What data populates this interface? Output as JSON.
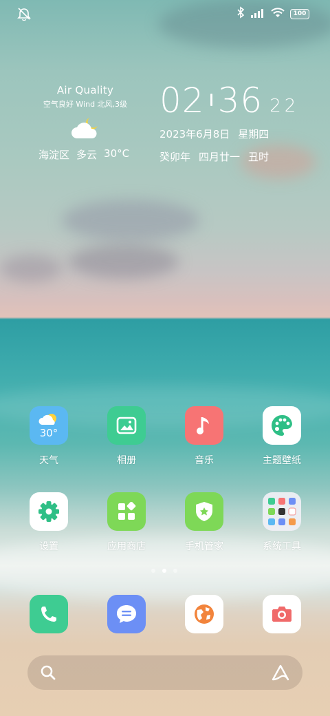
{
  "status_bar": {
    "left_icon": "mute-icon",
    "right_icons": [
      "bluetooth-icon",
      "signal-icon",
      "wifi-icon"
    ],
    "battery": "100"
  },
  "weather_widget": {
    "title": "Air Quality",
    "subtitle": "空气良好 Wind 北风,3级",
    "icon": "cloudy-night-icon",
    "district": "海淀区",
    "condition": "多云",
    "temperature": "30°C"
  },
  "clock_widget": {
    "hour": "02",
    "minute": "36",
    "second": "22",
    "date": "2023年6月8日",
    "weekday": "星期四",
    "lunar_year": "癸卯年",
    "lunar_date": "四月廿一",
    "lunar_hour": "丑时"
  },
  "apps_row1": [
    {
      "label": "天气",
      "icon": "weather-icon",
      "badge": "30°",
      "color": "#5bb8f2"
    },
    {
      "label": "相册",
      "icon": "gallery-icon",
      "color": "#3ecc92"
    },
    {
      "label": "音乐",
      "icon": "music-icon",
      "color": "#f77474"
    },
    {
      "label": "主题壁纸",
      "icon": "theme-palette-icon",
      "color": "#ffffff"
    }
  ],
  "apps_row2": [
    {
      "label": "设置",
      "icon": "settings-gear-icon",
      "color": "#ffffff"
    },
    {
      "label": "应用商店",
      "icon": "app-store-icon",
      "color": "#7ed857"
    },
    {
      "label": "手机管家",
      "icon": "security-shield-icon",
      "color": "#7ed857"
    },
    {
      "label": "系统工具",
      "icon": "folder-icon",
      "color": "#e8e8ee"
    }
  ],
  "pager": {
    "pages": 3,
    "active": 2
  },
  "dock": [
    {
      "name": "phone",
      "icon": "phone-icon",
      "color": "#3ecc92"
    },
    {
      "name": "messages",
      "icon": "message-icon",
      "color": "#6c8ff5"
    },
    {
      "name": "browser",
      "icon": "browser-globe-icon",
      "color": "#ffffff"
    },
    {
      "name": "camera",
      "icon": "camera-icon",
      "color": "#ffffff"
    }
  ],
  "search": {
    "icon": "search-icon",
    "assistant_icon": "assistant-icon"
  }
}
